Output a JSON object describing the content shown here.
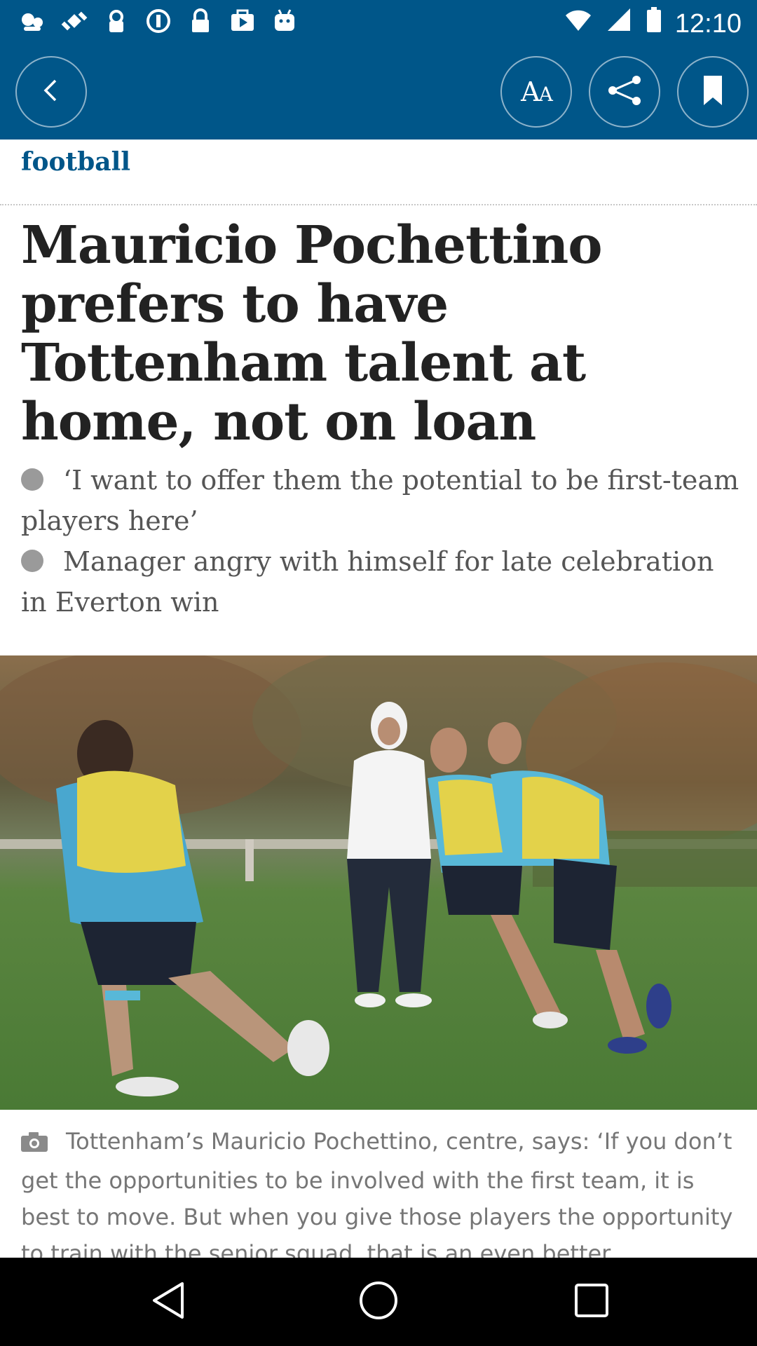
{
  "status_bar": {
    "time": "12:10",
    "left_icons": [
      "assistant-icon",
      "fake-gps-icon",
      "key-lock-icon",
      "sync-icon",
      "lock-icon",
      "play-store-icon",
      "android-icon"
    ],
    "right_icons": [
      "wifi-icon",
      "signal-icon",
      "battery-icon"
    ]
  },
  "toolbar": {
    "text_size_label_big": "A",
    "text_size_label_small": "A",
    "background_color": "#005689"
  },
  "article": {
    "section": "football",
    "headline": "Mauricio Pochettino prefers to have Tottenham talent at home, not on loan",
    "bullets": [
      "‘I want to offer them the potential to be first-team players here’",
      "Manager angry with himself for late celebration in Everton win"
    ],
    "caption": "Tottenham’s Mauricio Pochettino, centre, says: ‘If you don’t get the opportunities to be involved with the first team, it is best to move. But when you give those players the opportunity to train with the senior squad, that is an even better experience.’"
  },
  "colors": {
    "brand_blue": "#005689",
    "headline_text": "#222222",
    "body_text": "#555555",
    "caption_text": "#767676"
  }
}
